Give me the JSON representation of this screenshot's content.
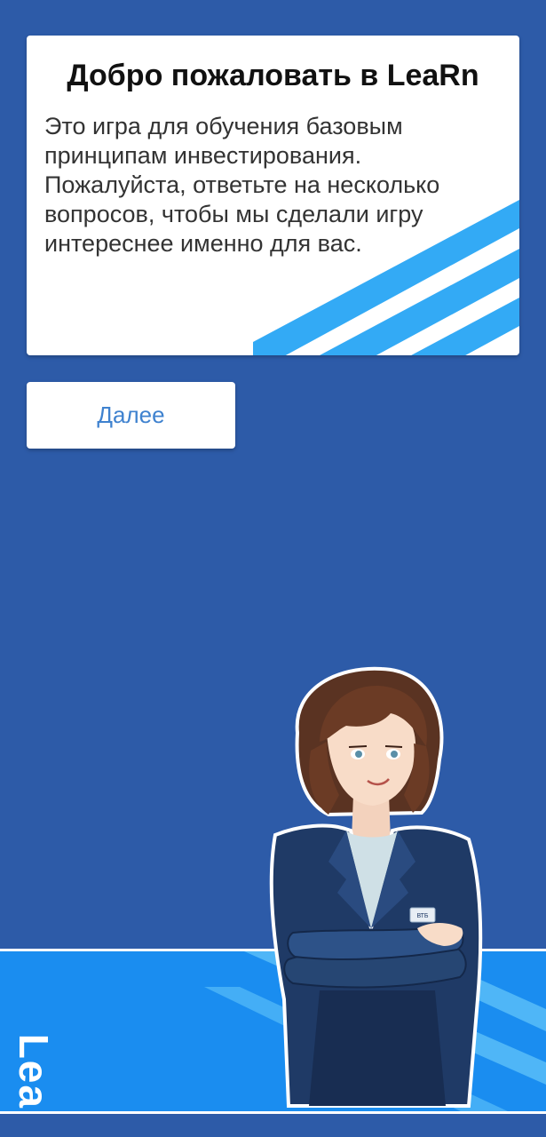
{
  "welcome_card": {
    "title": "Добро пожаловать в LeaRn",
    "body": "Это игра для обучения базовым принципам инвестирования. Пожалуйста, ответьте на несколько вопросов, чтобы мы сделали игру интереснее именно для вас."
  },
  "next_button": {
    "label": "Далее"
  },
  "banner": {
    "logo_text": "LeaRn"
  },
  "mascot": {
    "badge_text": "ВТБ"
  },
  "colors": {
    "background": "#2d5ba8",
    "card": "#ffffff",
    "accent_stripes": "#33aaf5",
    "banner": "#1a8df0",
    "button_text": "#3f82cf"
  }
}
